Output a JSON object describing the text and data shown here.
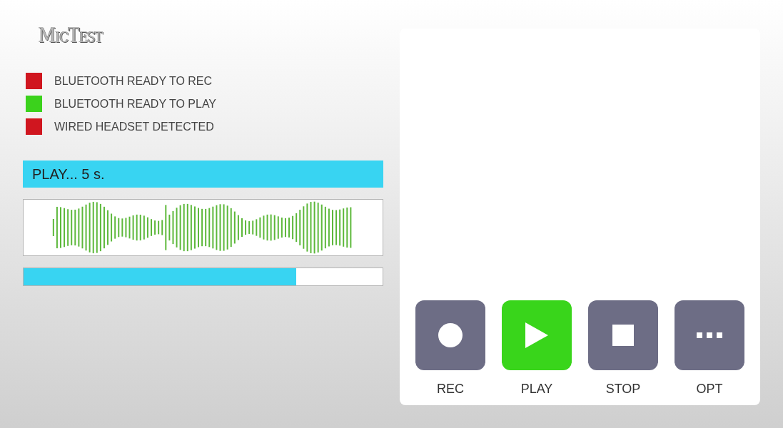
{
  "app": {
    "title": "MicTest"
  },
  "indicators": [
    {
      "label": "BLUETOOTH READY TO REC",
      "color": "#d0161f"
    },
    {
      "label": "BLUETOOTH READY TO PLAY",
      "color": "#3bd21c"
    },
    {
      "label": "WIRED HEADSET DETECTED",
      "color": "#d0161f"
    }
  ],
  "status": {
    "text": "PLAY... 5 s."
  },
  "progress": {
    "level": 0.76
  },
  "controls": [
    {
      "kind": "record",
      "label": "REC",
      "selected": false
    },
    {
      "kind": "play",
      "label": "PLAY",
      "selected": true
    },
    {
      "kind": "stop",
      "label": "STOP",
      "selected": false
    },
    {
      "kind": "more",
      "label": "OPT",
      "selected": false
    }
  ]
}
